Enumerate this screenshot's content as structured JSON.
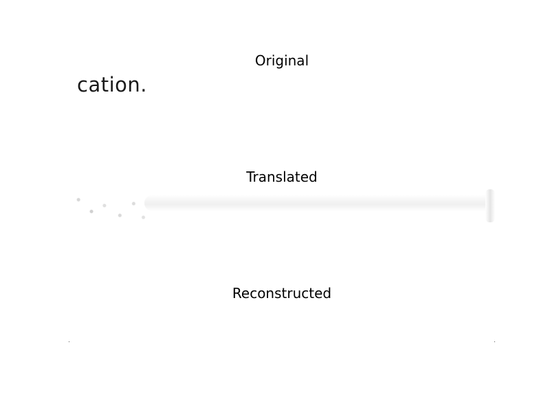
{
  "panels": {
    "original": {
      "title": "Original",
      "text": "cation."
    },
    "translated": {
      "title": "Translated"
    },
    "reconstructed": {
      "title": "Reconstructed"
    }
  },
  "colors": {
    "background": "#ffffff",
    "title_text": "#000000",
    "image_text": "#1a1a1a"
  }
}
